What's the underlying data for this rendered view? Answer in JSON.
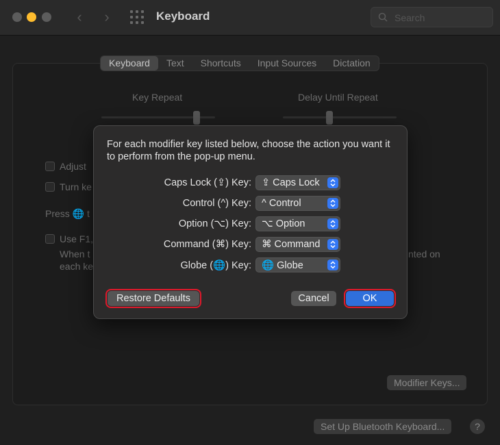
{
  "window": {
    "title": "Keyboard",
    "search_placeholder": "Search"
  },
  "tabs": [
    {
      "label": "Keyboard",
      "active": true
    },
    {
      "label": "Text"
    },
    {
      "label": "Shortcuts"
    },
    {
      "label": "Input Sources"
    },
    {
      "label": "Dictation"
    }
  ],
  "sliders": {
    "key_repeat_label": "Key Repeat",
    "delay_label": "Delay Until Repeat"
  },
  "background_rows": {
    "adjust": "Adjust",
    "turn": "Turn ke",
    "press": "Press",
    "press_globe_tail": "t",
    "use_f1": "Use F1,",
    "when": "When t",
    "each": "each ke",
    "right_fragment": "nted on"
  },
  "buttons": {
    "modifier_keys": "Modifier Keys...",
    "setup_bluetooth": "Set Up Bluetooth Keyboard...",
    "help": "?"
  },
  "dialog": {
    "text": "For each modifier key listed below, choose the action you want it to perform from the pop-up menu.",
    "rows": [
      {
        "label": "Caps Lock (⇪) Key:",
        "value": "⇪ Caps Lock"
      },
      {
        "label": "Control (^) Key:",
        "value": "^ Control"
      },
      {
        "label": "Option (⌥) Key:",
        "value": "⌥ Option"
      },
      {
        "label": "Command (⌘) Key:",
        "value": "⌘ Command"
      },
      {
        "label": "Globe (🌐) Key:",
        "value": "🌐 Globe"
      }
    ],
    "restore_label": "Restore Defaults",
    "cancel_label": "Cancel",
    "ok_label": "OK",
    "highlight_color": "#e0192b",
    "accent_color": "#2f6fdb"
  }
}
